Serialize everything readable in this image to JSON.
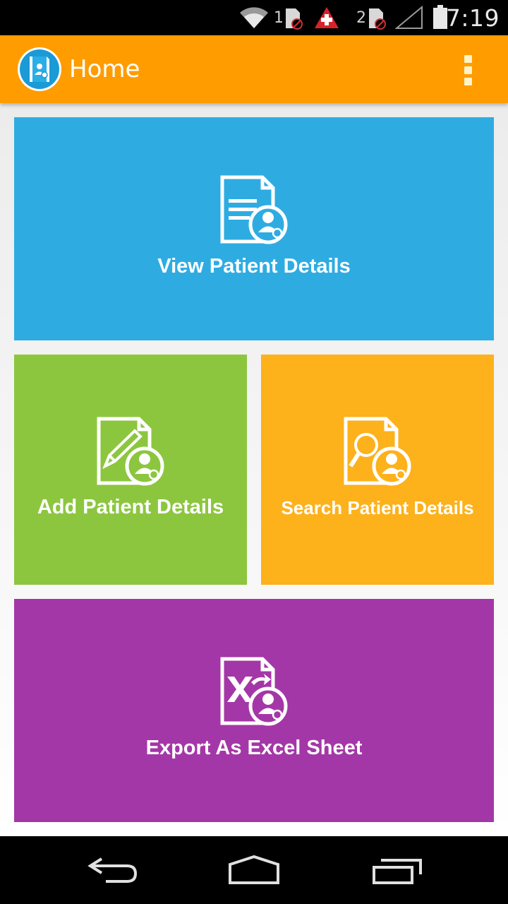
{
  "status_bar": {
    "time": "7:19",
    "sim1_label": "1",
    "sim2_label": "2",
    "icons": [
      "wifi-icon",
      "sim-1-icon",
      "alert-icon",
      "sim-2-icon",
      "signal-icon",
      "battery-icon"
    ]
  },
  "action_bar": {
    "title": "Home",
    "logo_icon": "medical-book-icon",
    "menu_icon": "overflow-menu-icon"
  },
  "tiles": [
    {
      "label": "View Patient Details",
      "icon": "patient-document-icon",
      "color": "#2eace2"
    },
    {
      "label": "Add Patient Details",
      "icon": "patient-edit-icon",
      "color": "#8cc63f"
    },
    {
      "label": "Search Patient Details",
      "icon": "patient-search-icon",
      "color": "#fdb11b"
    },
    {
      "label": "Export As Excel Sheet",
      "icon": "patient-excel-export-icon",
      "color": "#a437a7"
    }
  ],
  "colors": {
    "action_bar": "#ff9c00",
    "status_bar": "#000000",
    "nav_bar": "#000000"
  },
  "nav_bar": {
    "icons": [
      "back-icon",
      "home-icon",
      "recents-icon"
    ]
  }
}
